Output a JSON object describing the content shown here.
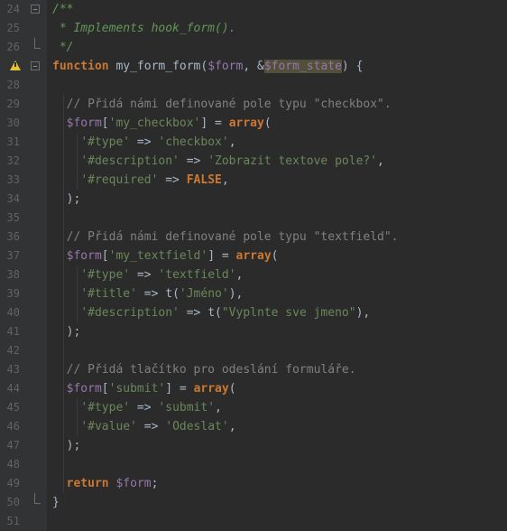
{
  "editor": {
    "gutter": {
      "line_numbers": [
        "24",
        "25",
        "26",
        "",
        "28",
        "29",
        "30",
        "31",
        "32",
        "33",
        "34",
        "35",
        "36",
        "37",
        "38",
        "39",
        "40",
        "41",
        "42",
        "43",
        "44",
        "45",
        "46",
        "47",
        "48",
        "49",
        "50",
        "51"
      ],
      "warning_line_index": 3,
      "warning_icon": "warning-icon",
      "fold_icon": "fold-toggle-icon"
    },
    "lines": [
      [
        {
          "t": "/**",
          "c": "doc"
        }
      ],
      [
        {
          "t": " * Implements hook_form().",
          "c": "doc"
        }
      ],
      [
        {
          "t": " */",
          "c": "doc"
        }
      ],
      [
        {
          "t": "function",
          "c": "kw"
        },
        {
          "t": " my_form_form(",
          "c": "fn"
        },
        {
          "t": "$form",
          "c": "var"
        },
        {
          "t": ", &",
          "c": "fn"
        },
        {
          "t": "$form_state",
          "c": "var hl"
        },
        {
          "t": ") {",
          "c": "fn"
        }
      ],
      [],
      [
        {
          "t": "  // Přidá námi definované pole typu \"checkbox\".",
          "c": "cmt"
        }
      ],
      [
        {
          "t": "  ",
          "c": "fn"
        },
        {
          "t": "$form",
          "c": "var"
        },
        {
          "t": "[",
          "c": "fn"
        },
        {
          "t": "'my_checkbox'",
          "c": "str"
        },
        {
          "t": "] = ",
          "c": "fn"
        },
        {
          "t": "array",
          "c": "kw"
        },
        {
          "t": "(",
          "c": "fn"
        }
      ],
      [
        {
          "t": "    ",
          "c": "fn"
        },
        {
          "t": "'#type'",
          "c": "str"
        },
        {
          "t": " => ",
          "c": "fn"
        },
        {
          "t": "'checkbox'",
          "c": "str"
        },
        {
          "t": ",",
          "c": "fn"
        }
      ],
      [
        {
          "t": "    ",
          "c": "fn"
        },
        {
          "t": "'#description'",
          "c": "str"
        },
        {
          "t": " => ",
          "c": "fn"
        },
        {
          "t": "'Zobrazit textove pole?'",
          "c": "str"
        },
        {
          "t": ",",
          "c": "fn"
        }
      ],
      [
        {
          "t": "    ",
          "c": "fn"
        },
        {
          "t": "'#required'",
          "c": "str"
        },
        {
          "t": " => ",
          "c": "fn"
        },
        {
          "t": "FALSE",
          "c": "kw"
        },
        {
          "t": ",",
          "c": "fn"
        }
      ],
      [
        {
          "t": "  );",
          "c": "fn"
        }
      ],
      [],
      [
        {
          "t": "  // Přidá námi definované pole typu \"textfield\".",
          "c": "cmt"
        }
      ],
      [
        {
          "t": "  ",
          "c": "fn"
        },
        {
          "t": "$form",
          "c": "var"
        },
        {
          "t": "[",
          "c": "fn"
        },
        {
          "t": "'my_textfield'",
          "c": "str"
        },
        {
          "t": "] = ",
          "c": "fn"
        },
        {
          "t": "array",
          "c": "kw"
        },
        {
          "t": "(",
          "c": "fn"
        }
      ],
      [
        {
          "t": "    ",
          "c": "fn"
        },
        {
          "t": "'#type'",
          "c": "str"
        },
        {
          "t": " => ",
          "c": "fn"
        },
        {
          "t": "'textfield'",
          "c": "str"
        },
        {
          "t": ",",
          "c": "fn"
        }
      ],
      [
        {
          "t": "    ",
          "c": "fn"
        },
        {
          "t": "'#title'",
          "c": "str"
        },
        {
          "t": " => t(",
          "c": "fn"
        },
        {
          "t": "'Jméno'",
          "c": "str"
        },
        {
          "t": "),",
          "c": "fn"
        }
      ],
      [
        {
          "t": "    ",
          "c": "fn"
        },
        {
          "t": "'#description'",
          "c": "str"
        },
        {
          "t": " => t(",
          "c": "fn"
        },
        {
          "t": "\"Vyplnte sve jmeno\"",
          "c": "str"
        },
        {
          "t": "),",
          "c": "fn"
        }
      ],
      [
        {
          "t": "  );",
          "c": "fn"
        }
      ],
      [],
      [
        {
          "t": "  // Přidá tlačítko pro odeslání formuláře.",
          "c": "cmt"
        }
      ],
      [
        {
          "t": "  ",
          "c": "fn"
        },
        {
          "t": "$form",
          "c": "var"
        },
        {
          "t": "[",
          "c": "fn"
        },
        {
          "t": "'submit'",
          "c": "str"
        },
        {
          "t": "] = ",
          "c": "fn"
        },
        {
          "t": "array",
          "c": "kw"
        },
        {
          "t": "(",
          "c": "fn"
        }
      ],
      [
        {
          "t": "    ",
          "c": "fn"
        },
        {
          "t": "'#type'",
          "c": "str"
        },
        {
          "t": " => ",
          "c": "fn"
        },
        {
          "t": "'submit'",
          "c": "str"
        },
        {
          "t": ",",
          "c": "fn"
        }
      ],
      [
        {
          "t": "    ",
          "c": "fn"
        },
        {
          "t": "'#value'",
          "c": "str"
        },
        {
          "t": " => ",
          "c": "fn"
        },
        {
          "t": "'Odeslat'",
          "c": "str"
        },
        {
          "t": ",",
          "c": "fn"
        }
      ],
      [
        {
          "t": "  );",
          "c": "fn"
        }
      ],
      [],
      [
        {
          "t": "  ",
          "c": "fn"
        },
        {
          "t": "return",
          "c": "kw"
        },
        {
          "t": " ",
          "c": "fn"
        },
        {
          "t": "$form",
          "c": "var"
        },
        {
          "t": ";",
          "c": "fn"
        }
      ],
      [
        {
          "t": "}",
          "c": "fn"
        }
      ],
      []
    ],
    "colors": {
      "background": "#2b2b2b",
      "gutter": "#313335",
      "keyword": "#cc7832",
      "variable": "#9876aa",
      "string": "#6a8759",
      "comment": "#808080",
      "doc_comment": "#629755",
      "warning": "#e3c33a",
      "highlight": "#52503a"
    }
  }
}
